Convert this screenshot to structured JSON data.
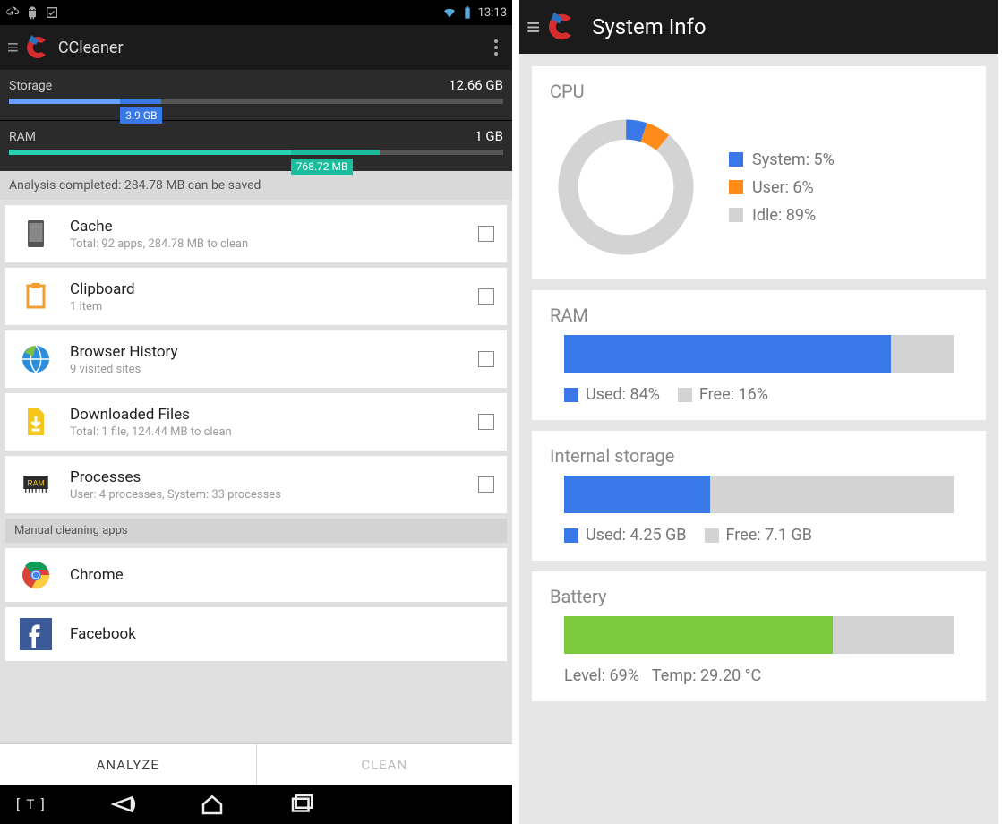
{
  "left": {
    "statusbar": {
      "time": "13:13"
    },
    "appbar": {
      "title": "CCleaner"
    },
    "storage": {
      "label": "Storage",
      "total": "12.66 GB",
      "used_label": "3.9 GB",
      "seg1_pct": 30.8,
      "seg2_pct": 22.5,
      "seg1_color": "#3b78e7",
      "seg2_color": "#6aa0ff"
    },
    "ram": {
      "label": "RAM",
      "total": "1 GB",
      "used_label": "768.72 MB",
      "seg1_pct": 75.0,
      "seg2_pct": 57.0,
      "seg1_color": "#1abc9c",
      "seg2_color": "#29d3b0"
    },
    "banner": "Analysis completed: 284.78 MB can be saved",
    "items": [
      {
        "title": "Cache",
        "sub": "Total: 92 apps, 284.78 MB to clean",
        "icon": "phone"
      },
      {
        "title": "Clipboard",
        "sub": "1 item",
        "icon": "clipboard"
      },
      {
        "title": "Browser History",
        "sub": "9 visited sites",
        "icon": "globe"
      },
      {
        "title": "Downloaded Files",
        "sub": "Total: 1 file, 124.44 MB to clean",
        "icon": "download"
      },
      {
        "title": "Processes",
        "sub": "User: 4 processes, System: 33 processes",
        "icon": "ram"
      }
    ],
    "manual_header": "Manual cleaning apps",
    "apps": [
      {
        "title": "Chrome",
        "icon": "chrome"
      },
      {
        "title": "Facebook",
        "icon": "facebook"
      }
    ],
    "buttons": {
      "analyze": "ANALYZE",
      "clean": "CLEAN"
    }
  },
  "right": {
    "appbar": {
      "title": "System Info"
    },
    "cpu": {
      "title": "CPU",
      "legend": [
        {
          "label": "System: 5%",
          "color": "#3b78e7"
        },
        {
          "label": "User: 6%",
          "color": "#ff8c1a"
        },
        {
          "label": "Idle: 89%",
          "color": "#d3d3d3"
        }
      ]
    },
    "ram": {
      "title": "RAM",
      "used_pct": 84,
      "fill_color": "#3b78e7",
      "legend": [
        {
          "label": "Used: 84%",
          "color": "#3b78e7"
        },
        {
          "label": "Free: 16%",
          "color": "#d3d3d3"
        }
      ]
    },
    "storage": {
      "title": "Internal storage",
      "used_pct": 37.4,
      "fill_color": "#3b78e7",
      "legend": [
        {
          "label": "Used: 4.25 GB",
          "color": "#3b78e7"
        },
        {
          "label": "Free: 7.1 GB",
          "color": "#d3d3d3"
        }
      ]
    },
    "battery": {
      "title": "Battery",
      "level_pct": 69,
      "fill_color": "#7cc93e",
      "level_label": "Level: 69%",
      "temp_label": "Temp: 29.20 °C"
    }
  },
  "chart_data": [
    {
      "type": "pie",
      "title": "CPU",
      "series": [
        {
          "name": "System",
          "value": 5,
          "color": "#3b78e7"
        },
        {
          "name": "User",
          "value": 6,
          "color": "#ff8c1a"
        },
        {
          "name": "Idle",
          "value": 89,
          "color": "#d3d3d3"
        }
      ]
    },
    {
      "type": "bar",
      "title": "RAM",
      "categories": [
        "Used",
        "Free"
      ],
      "values": [
        84,
        16
      ],
      "ylabel": "%",
      "ylim": [
        0,
        100
      ]
    },
    {
      "type": "bar",
      "title": "Internal storage",
      "categories": [
        "Used",
        "Free"
      ],
      "values": [
        4.25,
        7.1
      ],
      "ylabel": "GB"
    },
    {
      "type": "bar",
      "title": "Battery",
      "categories": [
        "Level"
      ],
      "values": [
        69
      ],
      "ylabel": "%",
      "ylim": [
        0,
        100
      ],
      "annotations": [
        "Temp: 29.20 °C"
      ]
    },
    {
      "type": "bar",
      "title": "Storage (home)",
      "categories": [
        "Used"
      ],
      "values": [
        3.9
      ],
      "ylabel": "GB",
      "ylim": [
        0,
        12.66
      ]
    },
    {
      "type": "bar",
      "title": "RAM (home)",
      "categories": [
        "Used"
      ],
      "values": [
        768.72
      ],
      "ylabel": "MB",
      "ylim": [
        0,
        1024
      ]
    }
  ]
}
